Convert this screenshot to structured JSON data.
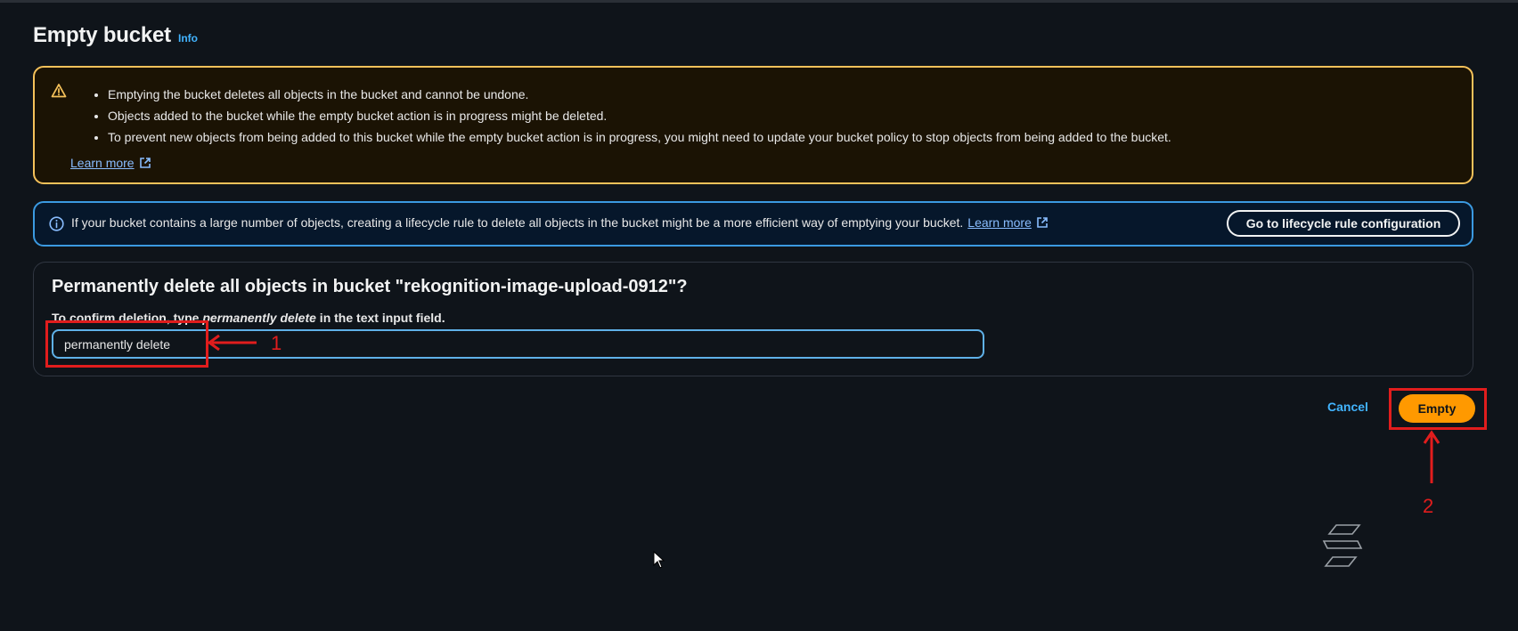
{
  "page": {
    "title": "Empty bucket",
    "info_label": "Info"
  },
  "warning": {
    "icon": "warning-triangle-icon",
    "items": [
      "Emptying the bucket deletes all objects in the bucket and cannot be undone.",
      "Objects added to the bucket while the empty bucket action is in progress might be deleted.",
      "To prevent new objects from being added to this bucket while the empty bucket action is in progress, you might need to update your bucket policy to stop objects from being added to the bucket."
    ],
    "learn_more": "Learn more"
  },
  "info_alert": {
    "icon": "info-circle-icon",
    "text": "If your bucket contains a large number of objects, creating a lifecycle rule to delete all objects in the bucket might be a more efficient way of emptying your bucket.",
    "learn_more": "Learn more",
    "button_label": "Go to lifecycle rule configuration"
  },
  "confirm": {
    "heading": "Permanently delete all objects in bucket \"rekognition-image-upload-0912\"?",
    "label_prefix": "To confirm deletion, type ",
    "label_emphasis": "permanently delete",
    "label_suffix": " in the text input field.",
    "input_value": "permanently delete"
  },
  "actions": {
    "cancel_label": "Cancel",
    "empty_label": "Empty"
  },
  "annotations": {
    "step1": "1",
    "step2": "2",
    "color": "#e11d1d"
  },
  "colors": {
    "background": "#0f141a",
    "warning_border": "#f5c15a",
    "info_border": "#3b9ae1",
    "primary_button": "#ff9900",
    "link": "#42b4ff"
  }
}
